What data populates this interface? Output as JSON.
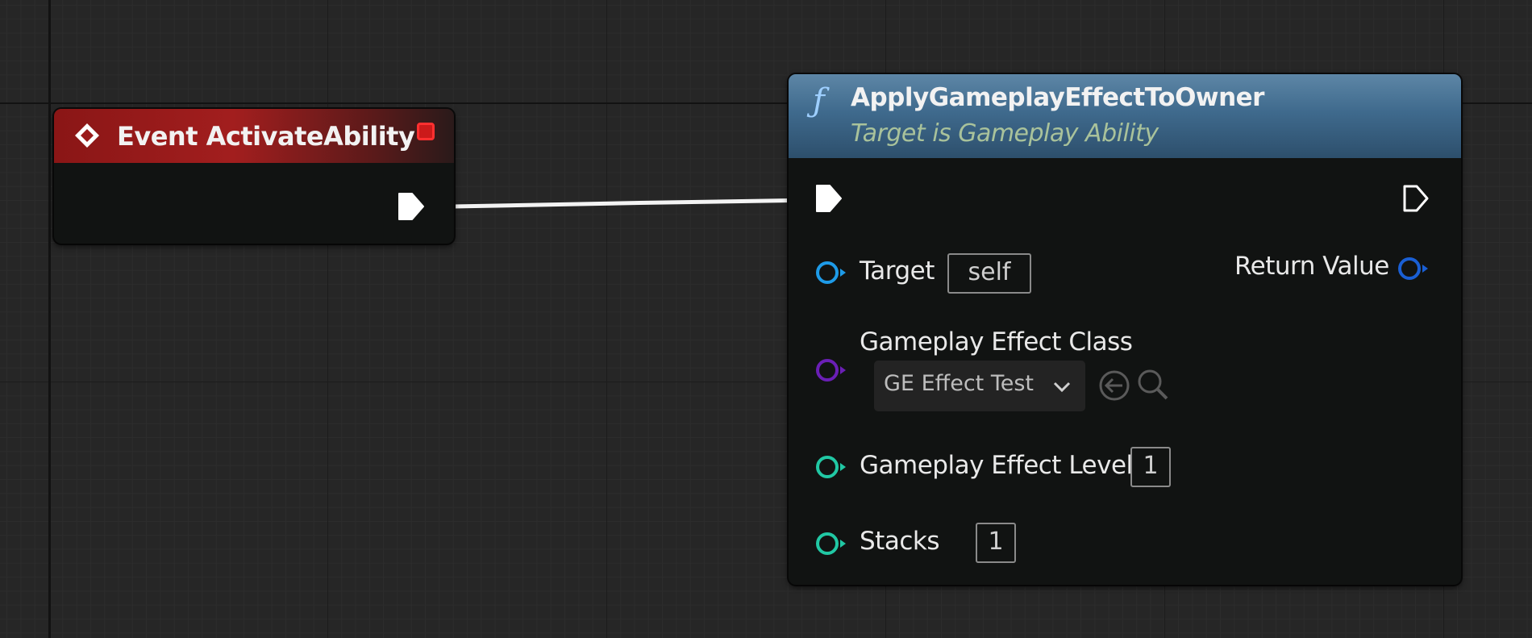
{
  "graph": {
    "event_node": {
      "title": "Event ActivateAbility",
      "icon": "event-diamond-icon",
      "header_color": "#a21e1e"
    },
    "function_node": {
      "icon": "function-f-icon",
      "title": "ApplyGameplayEffectToOwner",
      "subtitle": "Target is Gameplay Ability",
      "header_color": "#3f6a8d",
      "inputs": {
        "target": {
          "label": "Target",
          "value": "self",
          "color": "#1e9be8"
        },
        "effect_class": {
          "label": "Gameplay Effect Class",
          "selected": "GE Effect Test",
          "color": "#6a1fb5"
        },
        "effect_level": {
          "label": "Gameplay Effect Level",
          "value": "1",
          "color": "#21c8a4"
        },
        "stacks": {
          "label": "Stacks",
          "value": "1",
          "color": "#21c8a4"
        }
      },
      "outputs": {
        "return_value": {
          "label": "Return Value",
          "color": "#1a5fd4"
        }
      }
    },
    "wire_color": "#ffffff"
  }
}
